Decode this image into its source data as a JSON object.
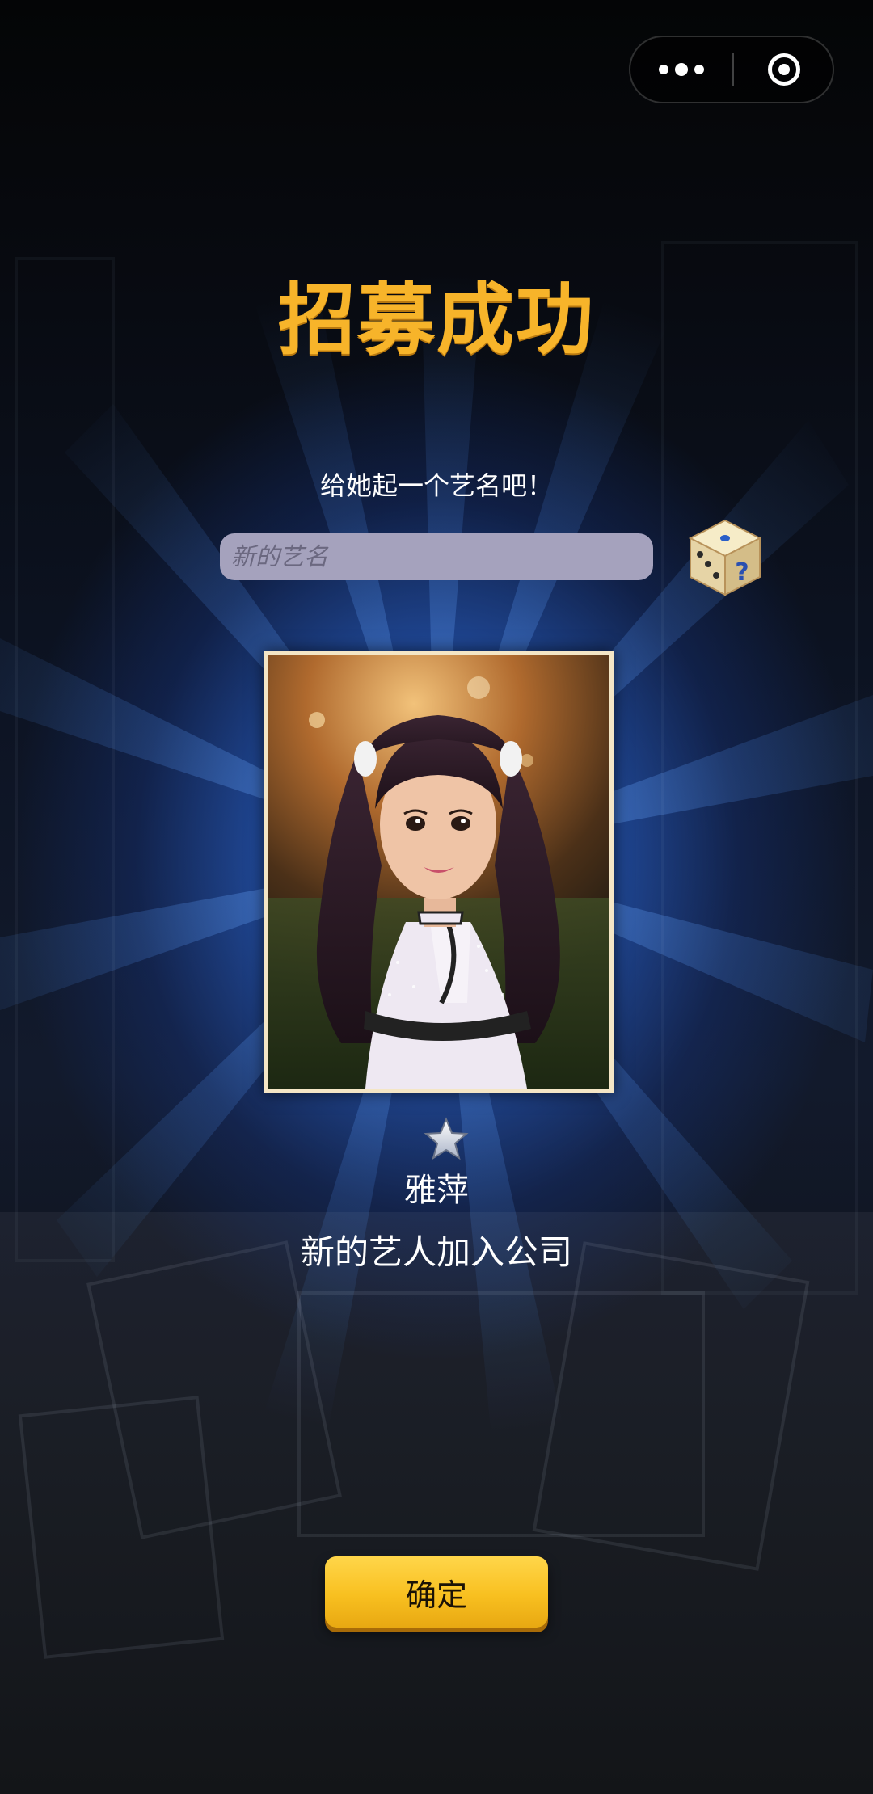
{
  "header": {
    "title": "招募成功"
  },
  "prompt": {
    "text": "给她起一个艺名吧！"
  },
  "name_input": {
    "placeholder": "新的艺名",
    "value": ""
  },
  "dice": {
    "icon": "random-name-dice-icon",
    "mark": "?"
  },
  "artist": {
    "name": "雅萍",
    "star_rating": 1
  },
  "message": {
    "text": "新的艺人加入公司"
  },
  "confirm": {
    "label": "确定"
  },
  "capsule": {
    "more_icon": "more-dots-icon",
    "close_icon": "close-miniprogram-icon"
  },
  "colors": {
    "title": "#f7b42a",
    "button": "#f8c020",
    "input_bg": "#a5a2bd",
    "glow": "#3c82e6"
  }
}
